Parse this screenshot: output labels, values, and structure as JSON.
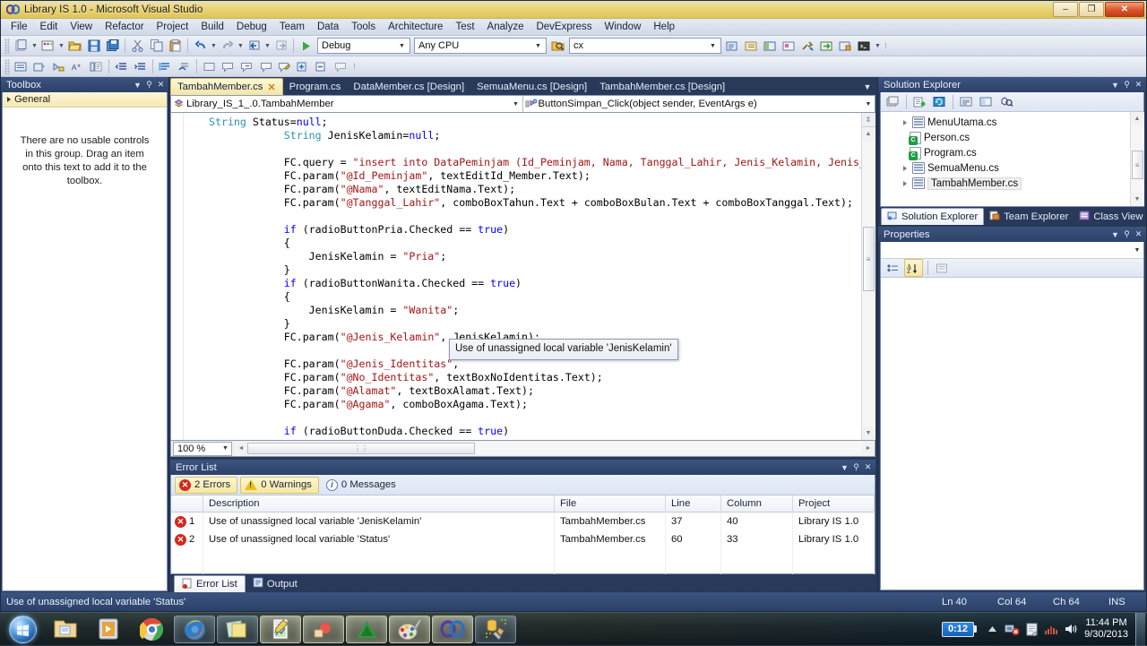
{
  "window": {
    "title": "Library IS 1.0 - Microsoft Visual Studio",
    "minimize_label": "–",
    "maximize_label": "❐",
    "close_label": "✕"
  },
  "menubar": {
    "items": [
      "File",
      "Edit",
      "View",
      "Refactor",
      "Project",
      "Build",
      "Debug",
      "Team",
      "Data",
      "Tools",
      "Architecture",
      "Test",
      "Analyze",
      "DevExpress",
      "Window",
      "Help"
    ]
  },
  "toolbar": {
    "config_value": "Debug",
    "platform_value": "Any CPU",
    "find_value": "cx",
    "start_label": "▶"
  },
  "toolbox": {
    "title": "Toolbox",
    "group_label": "General",
    "empty_text": "There are no usable controls in this group. Drag an item onto this text to add it to the toolbox."
  },
  "tabs": [
    {
      "label": "TambahMember.cs",
      "active": true,
      "close": "✕"
    },
    {
      "label": "Program.cs",
      "active": false
    },
    {
      "label": "DataMember.cs [Design]",
      "active": false
    },
    {
      "label": "SemuaMenu.cs [Design]",
      "active": false
    },
    {
      "label": "TambahMember.cs [Design]",
      "active": false
    }
  ],
  "navbar": {
    "class_value": "Library_IS_1_.0.TambahMember",
    "member_value": "ButtonSimpan_Click(object sender, EventArgs e)"
  },
  "editor": {
    "zoom": "100 %",
    "tooltip_text": "Use of unassigned local variable 'JenisKelamin'",
    "code_lines": [
      "            String Status=null;",
      "            String JenisKelamin=null;",
      "",
      "            FC.query = \"insert into DataPeminjam (Id_Peminjam, Nama, Tanggal_Lahir, Jenis_Kelamin, Jenis_Identit",
      "            FC.param(\"@Id_Peminjam\", textEditId_Member.Text);",
      "            FC.param(\"@Nama\", textEditNama.Text);",
      "            FC.param(\"@Tanggal_Lahir\", comboBoxTahun.Text + comboBoxBulan.Text + comboBoxTanggal.Text);",
      "",
      "            if (radioButtonPria.Checked == true)",
      "            {",
      "                JenisKelamin = \"Pria\";",
      "            }",
      "            if (radioButtonWanita.Checked == true)",
      "            {",
      "                JenisKelamin = \"Wanita\";",
      "            }",
      "            FC.param(\"@Jenis_Kelamin\", JenisKelamin);",
      "",
      "            FC.param(\"@Jenis_Identitas\",",
      "            FC.param(\"@No_Identitas\", textBoxNoIdentitas.Text);",
      "            FC.param(\"@Alamat\", textBoxAlamat.Text);",
      "            FC.param(\"@Agama\", comboBoxAgama.Text);",
      "",
      "            if (radioButtonDuda.Checked == true)"
    ]
  },
  "solution_explorer": {
    "title": "Solution Explorer",
    "items": [
      {
        "label": "MenuUtama.cs",
        "icon": "form-file-icon",
        "expandable": true,
        "selected": false
      },
      {
        "label": "Person.cs",
        "icon": "csharp-file-icon",
        "expandable": false,
        "selected": false
      },
      {
        "label": "Program.cs",
        "icon": "csharp-file-icon",
        "expandable": false,
        "selected": false
      },
      {
        "label": "SemuaMenu.cs",
        "icon": "form-file-icon",
        "expandable": true,
        "selected": false
      },
      {
        "label": "TambahMember.cs",
        "icon": "form-file-icon",
        "expandable": true,
        "selected": true
      }
    ],
    "tabs": [
      {
        "label": "Solution Explorer",
        "active": true
      },
      {
        "label": "Team Explorer",
        "active": false
      },
      {
        "label": "Class View",
        "active": false
      }
    ]
  },
  "properties": {
    "title": "Properties",
    "object_value": ""
  },
  "error_list": {
    "title": "Error List",
    "filters": [
      {
        "label": "2 Errors",
        "type": "error",
        "active": true
      },
      {
        "label": "0 Warnings",
        "type": "warning",
        "active": true
      },
      {
        "label": "0 Messages",
        "type": "message",
        "active": false
      }
    ],
    "columns": [
      "",
      "Description",
      "File",
      "Line",
      "Column",
      "Project"
    ],
    "rows": [
      {
        "num": "1",
        "description": "Use of unassigned local variable 'JenisKelamin'",
        "file": "TambahMember.cs",
        "line": "37",
        "column": "40",
        "project": "Library IS 1.0"
      },
      {
        "num": "2",
        "description": "Use of unassigned local variable 'Status'",
        "file": "TambahMember.cs",
        "line": "60",
        "column": "33",
        "project": "Library IS 1.0"
      }
    ],
    "tabs": [
      {
        "label": "Error List",
        "active": true
      },
      {
        "label": "Output",
        "active": false
      }
    ]
  },
  "statusbar": {
    "message": "Use of unassigned local variable 'Status'",
    "line": "Ln 40",
    "col": "Col 64",
    "ch": "Ch 64",
    "mode": "INS"
  },
  "taskbar": {
    "start_label": "Start",
    "items": [
      {
        "name": "windows-explorer",
        "state": "pinned"
      },
      {
        "name": "media-player",
        "state": "pinned"
      },
      {
        "name": "google-chrome",
        "state": "pinned"
      },
      {
        "name": "mozilla-firefox",
        "state": "open"
      },
      {
        "name": "sticky-notes",
        "state": "open"
      },
      {
        "name": "notepad-document",
        "state": "active"
      },
      {
        "name": "ccleaner",
        "state": "active"
      },
      {
        "name": "sketchup",
        "state": "active"
      },
      {
        "name": "paint-palette",
        "state": "active"
      },
      {
        "name": "visual-studio",
        "state": "active"
      },
      {
        "name": "sql-tools",
        "state": "open"
      }
    ],
    "battery_label": "0:12",
    "clock_time": "11:44 PM",
    "clock_date": "9/30/2013"
  },
  "colors": {
    "accent": "#2c4169",
    "title_gold": "#e8cf6a",
    "error_red": "#cf2a22",
    "warn_yellow": "#e8c020",
    "change_green": "#3fc93f",
    "keyword_blue": "#0000ff",
    "string_red": "#a31515",
    "type_teal": "#2b91af"
  }
}
